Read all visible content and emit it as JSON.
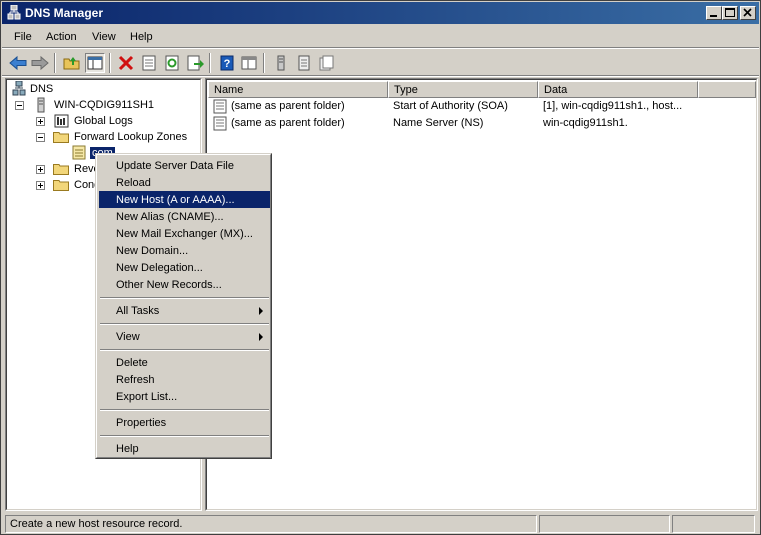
{
  "window": {
    "title": "DNS Manager",
    "colors": {
      "titlebar_start": "#0a246a",
      "titlebar_end": "#3a6ea5",
      "chrome": "#d4d0c8",
      "selection": "#0a246a"
    }
  },
  "menubar": {
    "items": [
      {
        "label": "File"
      },
      {
        "label": "Action"
      },
      {
        "label": "View"
      },
      {
        "label": "Help"
      }
    ]
  },
  "toolbar": {
    "buttons": [
      "back-icon",
      "forward-icon",
      "up-folder-icon",
      "show-hide-tree-icon",
      "delete-icon",
      "properties-icon",
      "refresh-icon",
      "export-icon",
      "help-icon",
      "console-icon",
      "server-icon",
      "zone-icon",
      "record-icon"
    ]
  },
  "tree": {
    "root": "DNS",
    "server": "WIN-CQDIG911SH1",
    "global_logs": "Global Logs",
    "forward_zones": "Forward Lookup Zones",
    "com_zone": "com",
    "reverse_zones": "Rever",
    "conditional": "Condi"
  },
  "list": {
    "columns": [
      {
        "label": "Name"
      },
      {
        "label": "Type"
      },
      {
        "label": "Data"
      }
    ],
    "rows": [
      {
        "name": "(same as parent folder)",
        "type": "Start of Authority (SOA)",
        "data": "[1], win-cqdig911sh1., host..."
      },
      {
        "name": "(same as parent folder)",
        "type": "Name Server (NS)",
        "data": "win-cqdig911sh1."
      }
    ]
  },
  "context_menu": {
    "items": [
      {
        "label": "Update Server Data File"
      },
      {
        "label": "Reload"
      },
      {
        "label": "New Host (A or AAAA)..."
      },
      {
        "label": "New Alias (CNAME)..."
      },
      {
        "label": "New Mail Exchanger (MX)..."
      },
      {
        "label": "New Domain..."
      },
      {
        "label": "New Delegation..."
      },
      {
        "label": "Other New Records..."
      },
      {
        "label": "All Tasks"
      },
      {
        "label": "View"
      },
      {
        "label": "Delete"
      },
      {
        "label": "Refresh"
      },
      {
        "label": "Export List..."
      },
      {
        "label": "Properties"
      },
      {
        "label": "Help"
      }
    ]
  },
  "statusbar": {
    "text": "Create a new host resource record."
  }
}
